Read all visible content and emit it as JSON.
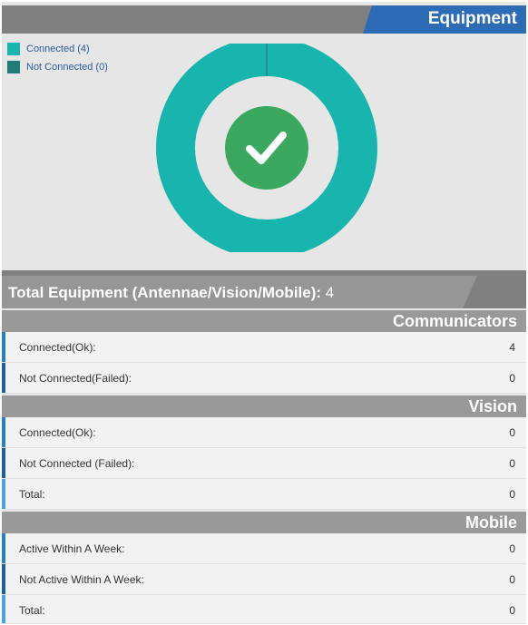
{
  "header": {
    "title": "Equipment"
  },
  "legend": [
    {
      "label": "Connected (4)",
      "color": "#17b5ad"
    },
    {
      "label": "Not Connected (0)",
      "color": "#1f7c76"
    }
  ],
  "chart_data": {
    "type": "pie",
    "categories": [
      "Connected",
      "Not Connected"
    ],
    "values": [
      4,
      0
    ],
    "colors": [
      "#17b5ad",
      "#1f7c76"
    ],
    "center_icon": "checkmark-icon",
    "center_color": "#3aa95f"
  },
  "total": {
    "label": "Total Equipment (Antennae/Vision/Mobile):",
    "value": "4"
  },
  "sections": [
    {
      "title": "Communicators",
      "rows": [
        {
          "label": "Connected(Ok):",
          "value": "4",
          "bar": "#2a7fc0"
        },
        {
          "label": "Not Connected(Failed):",
          "value": "0",
          "bar": "#1c5e9a"
        }
      ]
    },
    {
      "title": "Vision",
      "rows": [
        {
          "label": "Connected(Ok):",
          "value": "0",
          "bar": "#2a7fc0"
        },
        {
          "label": "Not Connected (Failed):",
          "value": "0",
          "bar": "#1c5e9a"
        },
        {
          "label": "Total:",
          "value": "0",
          "bar": "#4aa3df"
        }
      ]
    },
    {
      "title": "Mobile",
      "rows": [
        {
          "label": "Active Within A Week:",
          "value": "0",
          "bar": "#2a7fc0"
        },
        {
          "label": "Not Active Within A Week:",
          "value": "0",
          "bar": "#1c5e9a"
        },
        {
          "label": "Total:",
          "value": "0",
          "bar": "#4aa3df"
        }
      ]
    }
  ]
}
